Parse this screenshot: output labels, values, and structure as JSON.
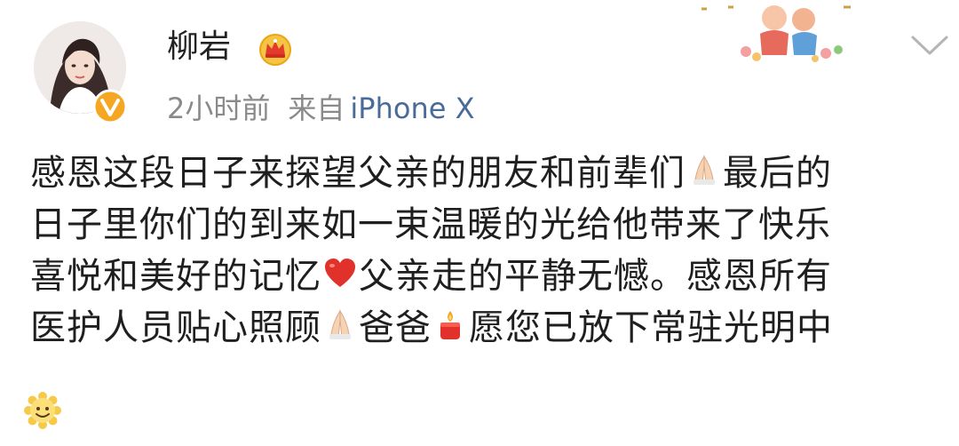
{
  "user": {
    "name": "柳岩",
    "avatar_icon": "avatar-photo",
    "verified_icon": "verified-v-icon",
    "rank_icon": "crown-icon"
  },
  "meta": {
    "time": "2小时前",
    "from_label": "来自",
    "device": "iPhone X"
  },
  "post": {
    "lines": [
      {
        "parts": [
          "感恩这段日子来探望父亲的朋友和前辈们",
          "最后的"
        ],
        "emoji": "folded-hands-icon"
      },
      {
        "parts": [
          "日子里你们的到来如一束温暖的光给他带来了快乐"
        ]
      },
      {
        "parts": [
          "喜悦和美好的记忆",
          "父亲走的平静无憾。感恩所有"
        ],
        "emoji": "heart-icon"
      },
      {
        "parts": [
          "医护人员贴心照顾",
          "爸爸",
          "愿您已放下常驻光明中"
        ],
        "emoji": [
          "folded-hands-icon",
          "candle-icon"
        ]
      }
    ],
    "trailing_emoji": "smile-icon"
  },
  "colors": {
    "link": "#4a6b9a",
    "meta": "#8a8a8a",
    "text": "#1f1f1f",
    "accent": "#f0a20e"
  }
}
